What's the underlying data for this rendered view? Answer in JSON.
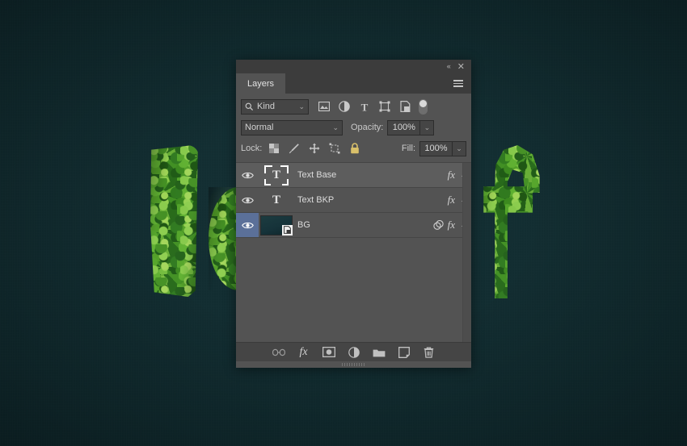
{
  "canvas": {
    "background_color": "#102a2e",
    "artwork": {
      "description": "ivy-foliage-letters",
      "letters": [
        {
          "name": "letter-i",
          "glyph": "I"
        },
        {
          "name": "letter-o",
          "glyph": "o"
        },
        {
          "name": "letter-f",
          "glyph": "f"
        }
      ],
      "foliage_color": "#4f8f34"
    }
  },
  "panel": {
    "titlebar": {
      "collapse_label": "«",
      "close_label": "✕"
    },
    "tab": {
      "label": "Layers",
      "menu_icon": "hamburger-menu-icon"
    },
    "filter": {
      "kind_label": "Kind",
      "search_icon": "magnifier-icon",
      "chevron": "⌄",
      "icons": [
        {
          "name": "filter-pixel-layers-icon",
          "title": "Pixel layers"
        },
        {
          "name": "filter-adjustment-layers-icon",
          "title": "Adjustment layers"
        },
        {
          "name": "filter-type-layers-icon",
          "title": "Type layers"
        },
        {
          "name": "filter-shape-layers-icon",
          "title": "Shape layers"
        },
        {
          "name": "filter-smart-object-icon",
          "title": "Smart objects"
        }
      ],
      "toggle_state": "on"
    },
    "blend": {
      "mode": "Normal",
      "chevron": "⌄",
      "opacity_label": "Opacity:",
      "opacity_value": "100%",
      "fill_label": "Fill:",
      "fill_value": "100%"
    },
    "lock": {
      "label": "Lock:",
      "icons": [
        {
          "name": "lock-transparent-pixels-icon"
        },
        {
          "name": "lock-image-pixels-icon"
        },
        {
          "name": "lock-position-icon"
        },
        {
          "name": "lock-artboard-nesting-icon"
        },
        {
          "name": "lock-all-icon"
        }
      ]
    },
    "layers": [
      {
        "name": "Text Base",
        "thumb_type": "text",
        "thumb_glyph": "T",
        "selected_thumb": true,
        "row_selected": true,
        "eye_visible": true,
        "eye_highlight": false,
        "has_fx": true,
        "has_mask_icon": false,
        "fx_label": "fx",
        "chevron": "⌄"
      },
      {
        "name": "Text BKP",
        "thumb_type": "text",
        "thumb_glyph": "T",
        "selected_thumb": false,
        "row_selected": false,
        "eye_visible": true,
        "eye_highlight": false,
        "has_fx": true,
        "has_mask_icon": false,
        "fx_label": "fx",
        "chevron": "⌄"
      },
      {
        "name": "BG",
        "thumb_type": "image",
        "thumb_glyph": "",
        "selected_thumb": false,
        "row_selected": false,
        "eye_visible": true,
        "eye_highlight": true,
        "has_fx": true,
        "has_mask_icon": true,
        "fx_label": "fx",
        "chevron": "⌄"
      }
    ],
    "footer": {
      "icons": [
        {
          "name": "link-layers-icon"
        },
        {
          "name": "layer-style-fx-icon",
          "label": "fx"
        },
        {
          "name": "add-layer-mask-icon"
        },
        {
          "name": "new-adjustment-layer-icon"
        },
        {
          "name": "new-group-icon"
        },
        {
          "name": "new-layer-icon"
        },
        {
          "name": "delete-layer-icon"
        }
      ]
    }
  },
  "colors": {
    "panel_bg": "#535353",
    "panel_chrome": "#3c3c3c",
    "selection_blue": "#5b7099",
    "row_selected": "#5d5d5d",
    "canvas_teal": "#102a2e"
  }
}
